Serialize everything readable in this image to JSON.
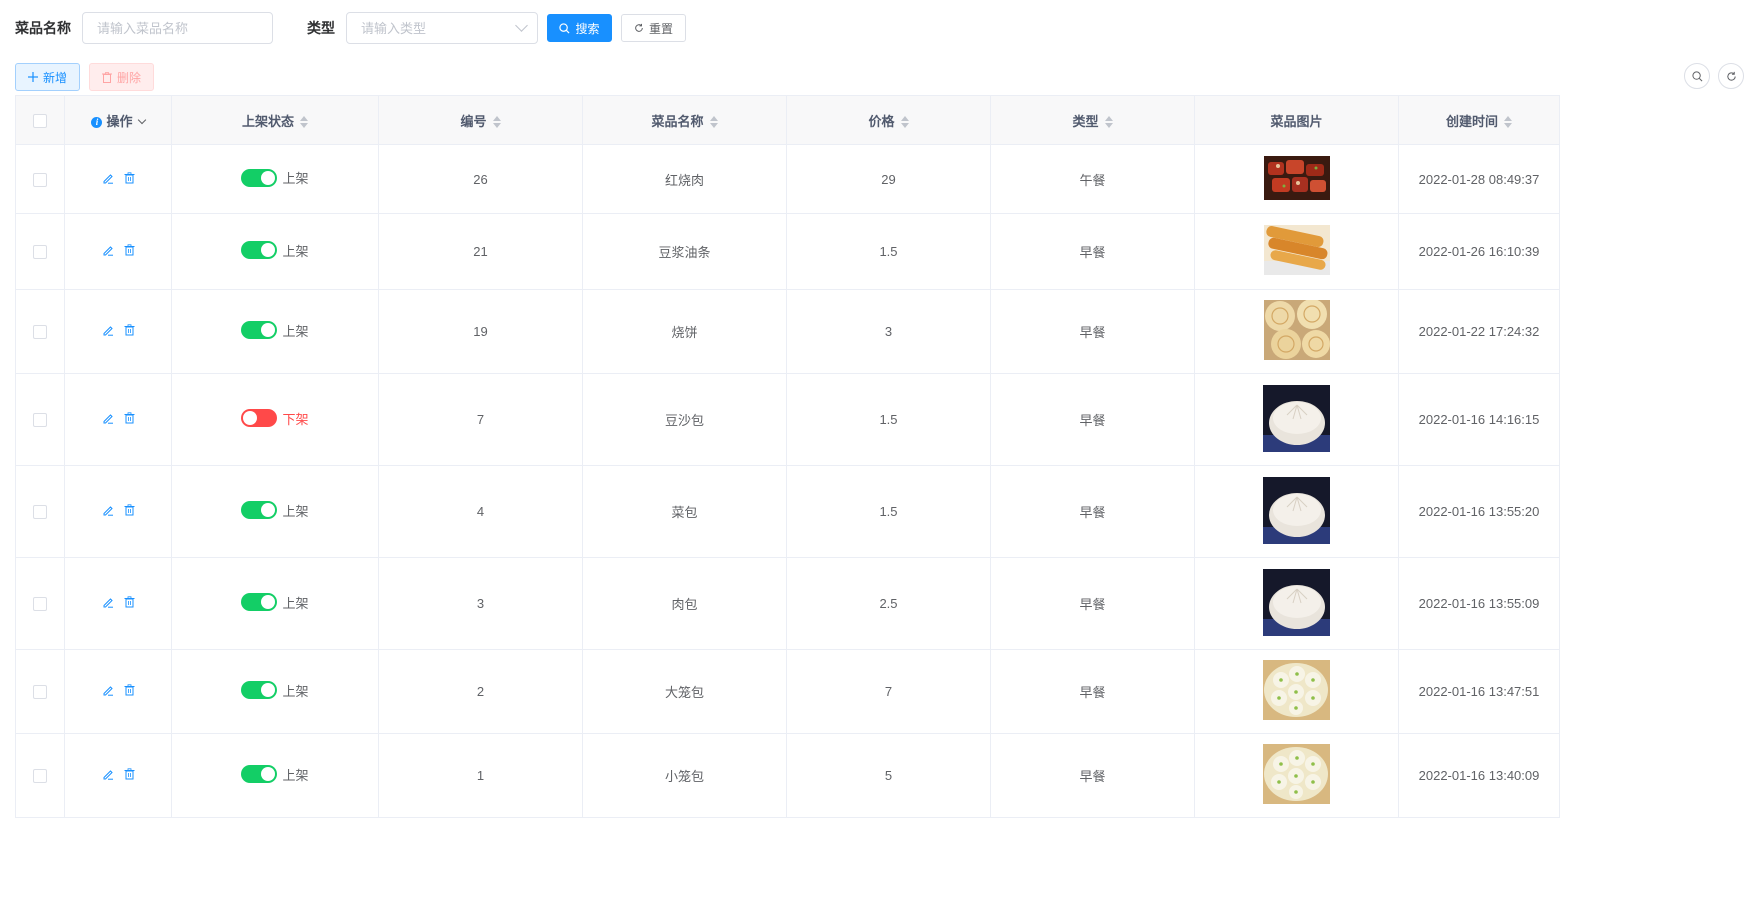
{
  "search": {
    "name_label": "菜品名称",
    "name_placeholder": "请输入菜品名称",
    "type_label": "类型",
    "type_placeholder": "请输入类型",
    "search_btn": "搜索",
    "reset_btn": "重置"
  },
  "toolbar": {
    "add_btn": "新增",
    "delete_btn": "删除"
  },
  "columns": {
    "ops": "操作",
    "status": "上架状态",
    "id": "编号",
    "name": "菜品名称",
    "price": "价格",
    "type": "类型",
    "image": "菜品图片",
    "created": "创建时间"
  },
  "rows": [
    {
      "status_on": true,
      "status": "上架",
      "id": "26",
      "name": "红烧肉",
      "price": "29",
      "type": "午餐",
      "image": "braised-pork",
      "created": "2022-01-28 08:49:37"
    },
    {
      "status_on": true,
      "status": "上架",
      "id": "21",
      "name": "豆浆油条",
      "price": "1.5",
      "type": "早餐",
      "image": "fried-dough",
      "created": "2022-01-26 16:10:39"
    },
    {
      "status_on": true,
      "status": "上架",
      "id": "19",
      "name": "烧饼",
      "price": "3",
      "type": "早餐",
      "image": "flatbread",
      "created": "2022-01-22 17:24:32"
    },
    {
      "status_on": false,
      "status": "下架",
      "id": "7",
      "name": "豆沙包",
      "price": "1.5",
      "type": "早餐",
      "image": "steamed-bun",
      "created": "2022-01-16 14:16:15"
    },
    {
      "status_on": true,
      "status": "上架",
      "id": "4",
      "name": "菜包",
      "price": "1.5",
      "type": "早餐",
      "image": "steamed-bun",
      "created": "2022-01-16 13:55:20"
    },
    {
      "status_on": true,
      "status": "上架",
      "id": "3",
      "name": "肉包",
      "price": "2.5",
      "type": "早餐",
      "image": "steamed-bun",
      "created": "2022-01-16 13:55:09"
    },
    {
      "status_on": true,
      "status": "上架",
      "id": "2",
      "name": "大笼包",
      "price": "7",
      "type": "早餐",
      "image": "dumpling-basket",
      "created": "2022-01-16 13:47:51"
    },
    {
      "status_on": true,
      "status": "上架",
      "id": "1",
      "name": "小笼包",
      "price": "5",
      "type": "早餐",
      "image": "dumpling-basket",
      "created": "2022-01-16 13:40:09"
    }
  ],
  "colors": {
    "primary": "#1890ff",
    "switch_on": "#13ce66",
    "switch_off": "#ff4949"
  }
}
